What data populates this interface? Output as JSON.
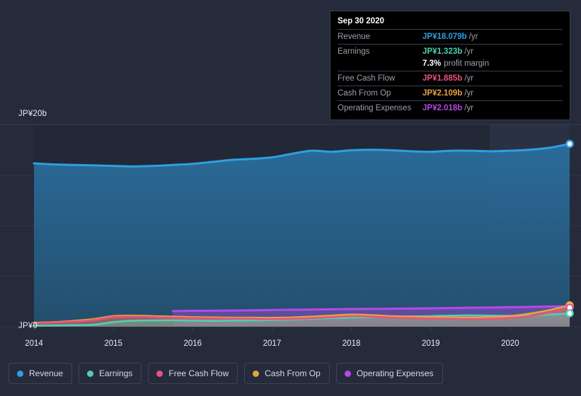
{
  "chart_data": {
    "type": "area",
    "title": "",
    "xlabel": "",
    "ylabel": "",
    "currency": "JP¥",
    "ylim": [
      0,
      20
    ],
    "y_axis_ticks": [
      "JP¥20b",
      "JP¥0"
    ],
    "y_top_label": "JP¥20b",
    "y_zero_label": "JP¥0",
    "grid": true,
    "legend_position": "bottom",
    "x_tick_labels": [
      "2014",
      "2015",
      "2016",
      "2017",
      "2018",
      "2019",
      "2020"
    ],
    "x": [
      2014.0,
      2014.25,
      2014.5,
      2014.75,
      2015.0,
      2015.25,
      2015.5,
      2015.75,
      2016.0,
      2016.25,
      2016.5,
      2016.75,
      2017.0,
      2017.25,
      2017.5,
      2017.75,
      2018.0,
      2018.25,
      2018.5,
      2018.75,
      2019.0,
      2019.25,
      2019.5,
      2019.75,
      2020.0,
      2020.25,
      2020.5,
      2020.75
    ],
    "series": [
      {
        "name": "Revenue",
        "color": "#2f9fe0",
        "unit": "b",
        "values": [
          16.15,
          16.05,
          16.0,
          15.95,
          15.9,
          15.85,
          15.9,
          16.0,
          16.1,
          16.3,
          16.5,
          16.6,
          16.75,
          17.1,
          17.4,
          17.3,
          17.45,
          17.5,
          17.45,
          17.35,
          17.3,
          17.4,
          17.4,
          17.35,
          17.4,
          17.5,
          17.7,
          18.079
        ]
      },
      {
        "name": "Earnings",
        "color": "#4dd0b1",
        "unit": "b",
        "values": [
          0.1,
          0.12,
          0.15,
          0.2,
          0.45,
          0.6,
          0.62,
          0.63,
          0.6,
          0.58,
          0.6,
          0.62,
          0.65,
          0.7,
          0.78,
          0.85,
          0.9,
          0.95,
          1.0,
          1.02,
          1.05,
          1.1,
          1.12,
          1.1,
          1.08,
          1.1,
          1.2,
          1.323
        ]
      },
      {
        "name": "Free Cash Flow",
        "color": "#e8527f",
        "unit": "b",
        "values": [
          0.35,
          0.4,
          0.5,
          0.65,
          0.95,
          1.0,
          0.95,
          0.9,
          0.85,
          0.82,
          0.8,
          0.78,
          0.75,
          0.78,
          0.85,
          0.95,
          1.05,
          1.0,
          0.9,
          0.85,
          0.8,
          0.78,
          0.75,
          0.78,
          0.85,
          1.05,
          1.4,
          1.885
        ]
      },
      {
        "name": "Cash From Op",
        "color": "#e8a33d",
        "unit": "b",
        "values": [
          0.4,
          0.45,
          0.58,
          0.75,
          1.05,
          1.1,
          1.05,
          1.0,
          0.95,
          0.92,
          0.9,
          0.9,
          0.88,
          0.92,
          1.0,
          1.1,
          1.2,
          1.15,
          1.05,
          1.0,
          0.95,
          0.92,
          0.9,
          0.95,
          1.05,
          1.3,
          1.65,
          2.109
        ]
      },
      {
        "name": "Operating Expenses",
        "color": "#b44ae8",
        "unit": "b",
        "start_index": 7,
        "values": [
          null,
          null,
          null,
          null,
          null,
          null,
          null,
          1.55,
          1.57,
          1.58,
          1.6,
          1.62,
          1.65,
          1.68,
          1.7,
          1.72,
          1.75,
          1.76,
          1.78,
          1.8,
          1.82,
          1.85,
          1.88,
          1.9,
          1.93,
          1.96,
          1.99,
          2.018
        ]
      }
    ]
  },
  "tooltip": {
    "date": "Sep 30 2020",
    "rows": [
      {
        "label": "Revenue",
        "value": "JP¥18.079b",
        "unit": "/yr",
        "color": "#2f9fe0"
      },
      {
        "label": "Earnings",
        "value": "JP¥1.323b",
        "unit": "/yr",
        "color": "#4dd0b1"
      },
      {
        "label": "Free Cash Flow",
        "value": "JP¥1.885b",
        "unit": "/yr",
        "color": "#e8527f"
      },
      {
        "label": "Cash From Op",
        "value": "JP¥2.109b",
        "unit": "/yr",
        "color": "#e8a33d"
      },
      {
        "label": "Operating Expenses",
        "value": "JP¥2.018b",
        "unit": "/yr",
        "color": "#b44ae8"
      }
    ],
    "profit_margin_value": "7.3%",
    "profit_margin_label": "profit margin"
  },
  "legend": {
    "items": [
      {
        "label": "Revenue",
        "color": "#2f9fe0"
      },
      {
        "label": "Earnings",
        "color": "#4dd0b1"
      },
      {
        "label": "Free Cash Flow",
        "color": "#e8527f"
      },
      {
        "label": "Cash From Op",
        "color": "#e8a33d"
      },
      {
        "label": "Operating Expenses",
        "color": "#b44ae8"
      }
    ]
  },
  "theme": {
    "background": "#252b3b",
    "plot_background": "#232836",
    "gridline": "#3a4152",
    "text": "#e9edf2",
    "muted_text": "#9aa0ab"
  }
}
